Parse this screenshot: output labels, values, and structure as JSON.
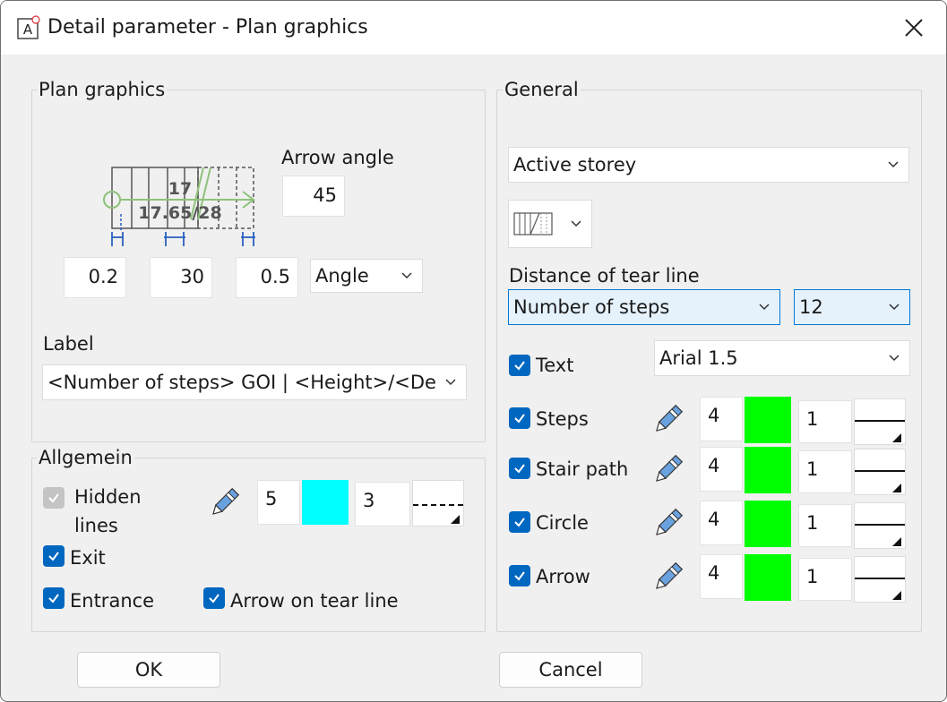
{
  "window": {
    "title": "Detail parameter - Plan graphics",
    "icon": "app-icon",
    "close_icon": "close-icon"
  },
  "plan_graphics": {
    "group_label": "Plan graphics",
    "arrow_angle_label": "Arrow angle",
    "arrow_angle_value": "45",
    "diagram": {
      "steps_text": "17",
      "height_depth_text": "17.65/28"
    },
    "dim_start": "0.2",
    "dim_step": "30",
    "dim_end": "0.5",
    "arrow_type": "Angle",
    "label_caption": "Label",
    "label_value": "<Number of steps> GOI | <Height>/<De"
  },
  "allgemein": {
    "group_label": "Allgemein",
    "hidden_lines_label_line1": "Hidden",
    "hidden_lines_label_line2": "lines",
    "hidden_lines_pen": "5",
    "hidden_lines_color": "#00ffff",
    "hidden_lines_line": "3",
    "exit_label": "Exit",
    "entrance_label": "Entrance",
    "arrow_on_tear_line_label": "Arrow on tear line"
  },
  "general": {
    "group_label": "General",
    "storey": "Active storey",
    "tear_line_caption": "Distance of tear line",
    "tear_line_mode": "Number of steps",
    "tear_line_value": "12",
    "text_label": "Text",
    "text_font": "Arial 1.5",
    "rows": [
      {
        "label": "Steps",
        "pen": "4",
        "color": "#00ff00",
        "line": "1"
      },
      {
        "label": "Stair path",
        "pen": "4",
        "color": "#00ff00",
        "line": "1"
      },
      {
        "label": "Circle",
        "pen": "4",
        "color": "#00ff00",
        "line": "1"
      },
      {
        "label": "Arrow",
        "pen": "4",
        "color": "#00ff00",
        "line": "1"
      }
    ]
  },
  "buttons": {
    "ok": "OK",
    "cancel": "Cancel"
  }
}
